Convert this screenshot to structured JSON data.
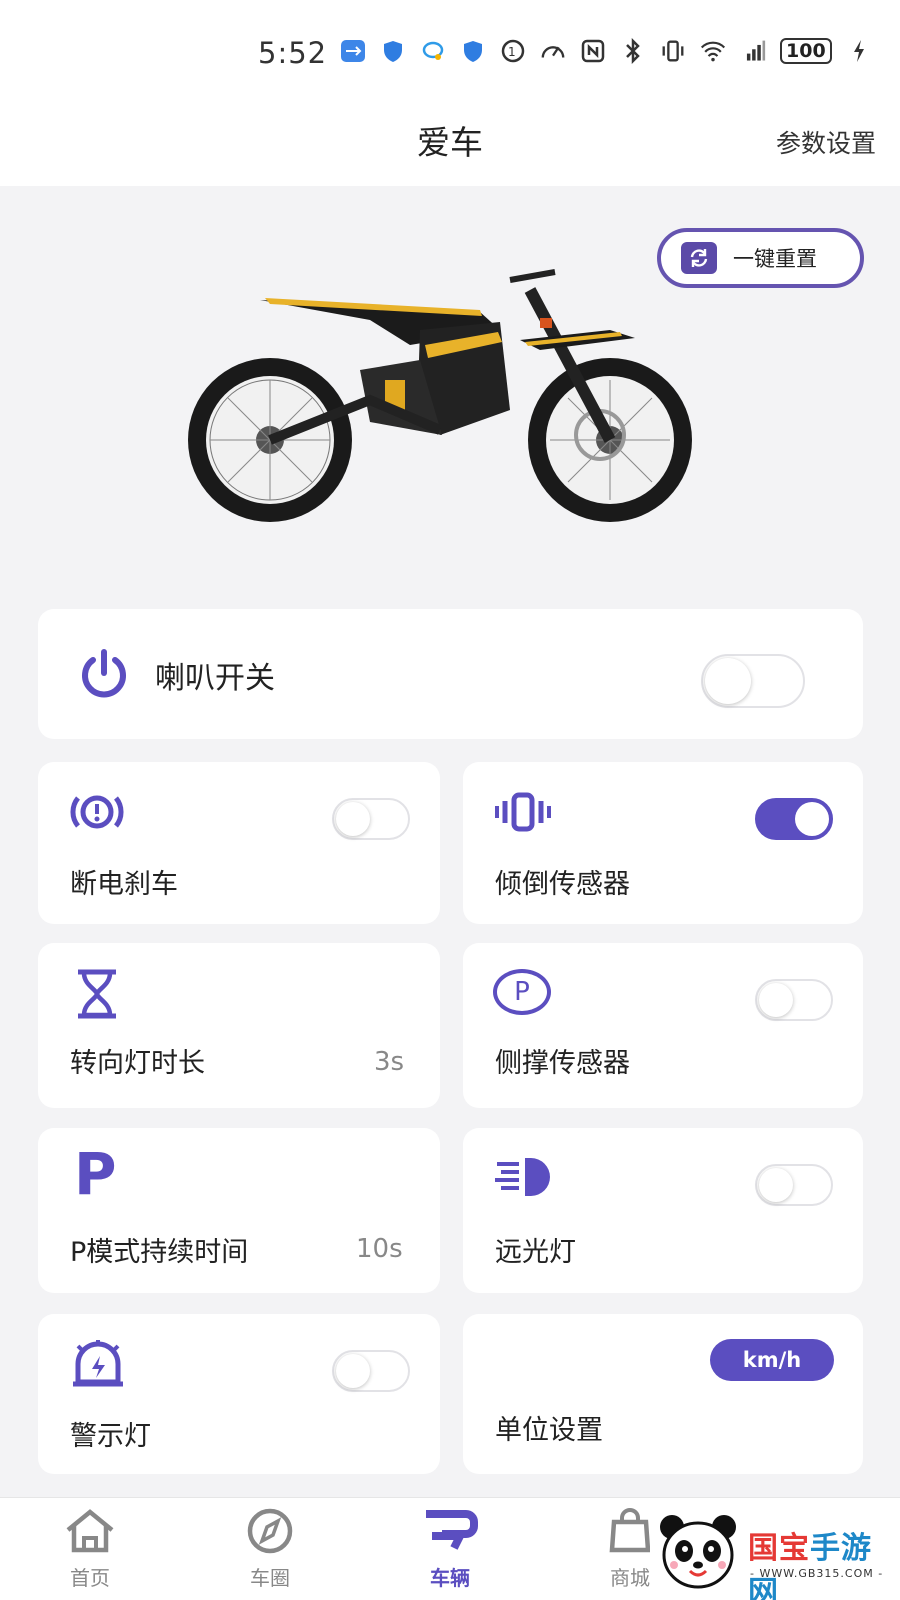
{
  "status_bar": {
    "time": "5:52",
    "battery": "100",
    "icons": [
      "usb-icon",
      "shield-icon",
      "chat-icon",
      "shield-icon",
      "data-saver-icon",
      "speed-icon",
      "nfc-icon",
      "bluetooth-icon",
      "vibrate-icon",
      "wifi-icon",
      "signal-4g-icon",
      "charging-icon"
    ]
  },
  "header": {
    "title": "爱车",
    "right_action": "参数设置"
  },
  "reset_button": {
    "label": "一键重置"
  },
  "horn": {
    "label": "喇叭开关",
    "on": false
  },
  "tiles": {
    "brake_cut": {
      "label": "断电刹车",
      "on": false
    },
    "tilt_sensor": {
      "label": "倾倒传感器",
      "on": true
    },
    "turn_signal": {
      "label": "转向灯时长",
      "value": "3s"
    },
    "kickstand_sensor": {
      "label": "侧撑传感器",
      "on": false
    },
    "p_mode": {
      "label": "P模式持续时间",
      "value": "10s",
      "icon_text": "P"
    },
    "high_beam": {
      "label": "远光灯",
      "on": false
    },
    "warning_light": {
      "label": "警示灯",
      "on": false
    },
    "unit": {
      "label": "单位设置",
      "badge": "km/h"
    }
  },
  "kickstand_icon_text": "P",
  "bottom_nav": {
    "items": [
      {
        "label": "首页",
        "icon": "home-icon"
      },
      {
        "label": "车圈",
        "icon": "compass-icon"
      },
      {
        "label": "车辆",
        "icon": "vehicle-icon",
        "active": true
      },
      {
        "label": "商城",
        "icon": "shop-bag-icon"
      }
    ]
  },
  "watermark": {
    "title_red": "国宝",
    "title_blue": "手游网",
    "url": "- WWW.GB315.COM -"
  },
  "colors": {
    "accent": "#5b4ec0",
    "background": "#f3f3f5"
  }
}
